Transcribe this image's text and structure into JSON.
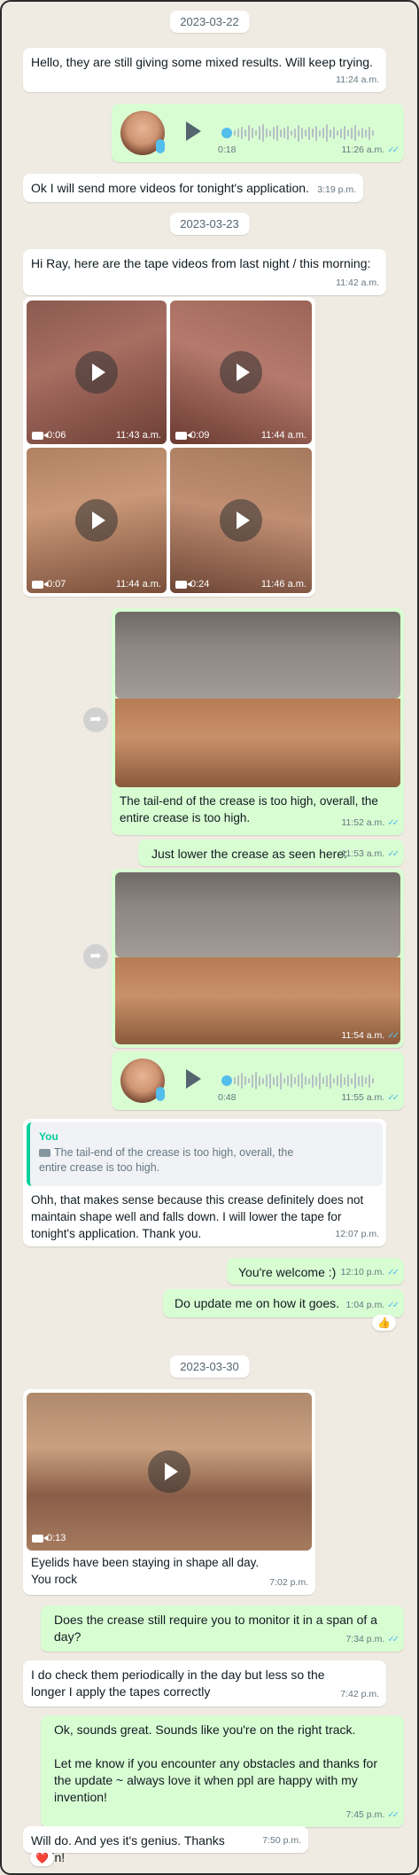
{
  "dates": [
    "2023-03-22",
    "2023-03-23",
    "2023-03-30"
  ],
  "msgs": {
    "m1": {
      "text": "Hello, they are still giving some mixed results. Will keep trying.",
      "time": "11:24 a.m."
    },
    "v1": {
      "duration": "0:18",
      "time": "11:26 a.m."
    },
    "m2": {
      "text": "Ok I will send more videos for tonight's application.",
      "time": "3:19 p.m."
    },
    "m3": {
      "text": "Hi Ray, here are the tape videos from last night / this morning:",
      "time": "11:42 a.m."
    },
    "vid1": {
      "duration": "0:06",
      "time": "11:43 a.m."
    },
    "vid2": {
      "duration": "0:09",
      "time": "11:44 a.m."
    },
    "vid3": {
      "duration": "0:07",
      "time": "11:44 a.m."
    },
    "vid4": {
      "duration": "0:24",
      "time": "11:46 a.m."
    },
    "img1": {
      "caption": "The tail-end of the crease is too high, overall, the entire crease is too high.",
      "time": "11:52 a.m."
    },
    "m4": {
      "text": "Just lower the crease as seen here:",
      "time": "11:53 a.m."
    },
    "img2": {
      "time": "11:54 a.m."
    },
    "v2": {
      "duration": "0:48",
      "time": "11:55 a.m."
    },
    "reply": {
      "quote_name": "You",
      "quote_text": "The tail-end of the crease is too high, overall, the entire crease is too high.",
      "text": "Ohh, that makes sense because this crease definitely does not maintain shape well and falls down. I will lower the tape for tonight's application. Thank you.",
      "time": "12:07 p.m."
    },
    "m5": {
      "text": "You're welcome :)",
      "time": "12:10 p.m."
    },
    "m6": {
      "text": "Do update me on how it goes.",
      "time": "1:04 p.m.",
      "reaction": "👍"
    },
    "vid5": {
      "duration": "0:13",
      "caption": "Eyelids have been staying in shape all day. You rock",
      "time": "7:02 p.m."
    },
    "m7": {
      "text": "Does the crease still require you to monitor it in a span of a day?",
      "time": "7:34 p.m."
    },
    "m8": {
      "text": "I do check them periodically in the day but less so the longer I apply the tapes correctly",
      "time": "7:42 p.m."
    },
    "m9": {
      "text1": "Ok, sounds great. Sounds like you're on the right track.",
      "text2": "Let me know if you encounter any obstacles and thanks for the update ~ always love it when ppl are happy with my invention!",
      "time": "7:45 p.m."
    },
    "m10": {
      "text": "Will do. And yes it's genius. Thanks again!",
      "time": "7:50 p.m.",
      "reaction": "❤️"
    }
  },
  "colors": {
    "incoming": "#ffffff",
    "outgoing": "#d9fdd3",
    "background": "#efeae2",
    "read_tick": "#53bdeb",
    "quote_accent": "#06cf9c"
  },
  "icons": {
    "read": "double-check-icon",
    "video": "camera-icon",
    "forward": "forward-icon",
    "play": "play-icon",
    "mic": "mic-icon"
  }
}
